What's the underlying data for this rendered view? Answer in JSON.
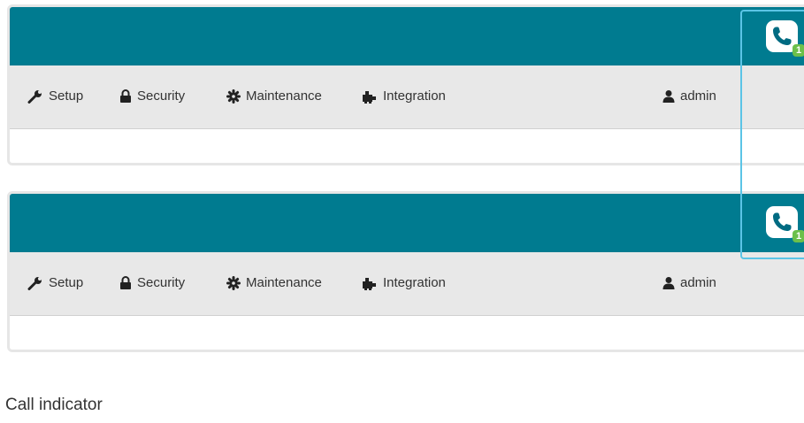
{
  "panels": [
    {
      "nav": {
        "setup": "Setup",
        "security": "Security",
        "maintenance": "Maintenance",
        "integration": "Integration",
        "user": "admin"
      },
      "call_indicator": {
        "icon": "phone-icon",
        "badge": "1"
      }
    },
    {
      "nav": {
        "setup": "Setup",
        "security": "Security",
        "maintenance": "Maintenance",
        "integration": "Integration",
        "user": "admin"
      },
      "call_indicator": {
        "icon": "phone-icon",
        "badge": "1"
      }
    }
  ],
  "caption": "Call indicator",
  "colors": {
    "header": "#007b90",
    "nav_bg": "#e8e8e8",
    "badge": "#6cc04a",
    "highlight": "#5bc4e6"
  }
}
